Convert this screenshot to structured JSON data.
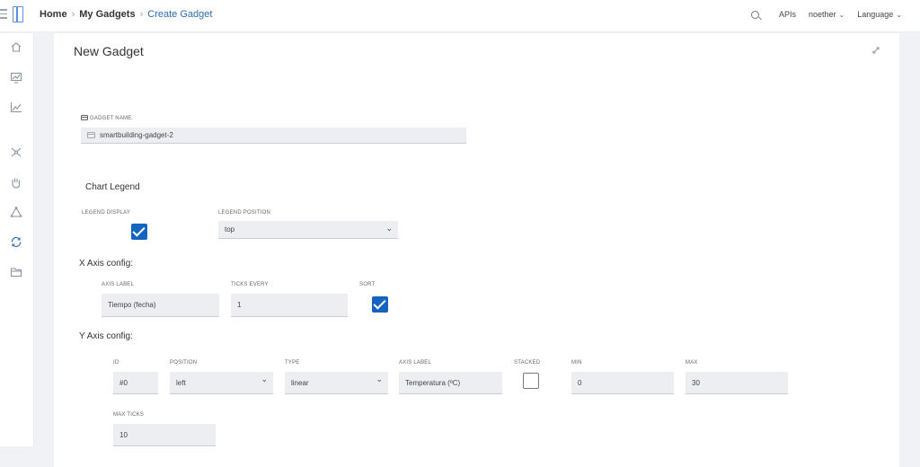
{
  "header": {
    "breadcrumb": [
      "Home",
      "My Gadgets",
      "Create Gadget"
    ],
    "apis": "APIs",
    "user": "noether",
    "language": "Language"
  },
  "page": {
    "title": "New Gadget"
  },
  "gadget": {
    "name_label": "GADGET NAME:",
    "name_value": "smartbuilding-gadget-2"
  },
  "legend": {
    "section_title": "Chart Legend",
    "display_label": "LEGEND DISPLAY",
    "display_checked": true,
    "position_label": "LEGEND POSITION",
    "position_value": "top"
  },
  "xaxis": {
    "section_title": "X Axis config:",
    "axis_label_label": "AXIS LABEL",
    "axis_label_value": "Tiempo (fecha)",
    "ticks_label": "TICKS EVERY",
    "ticks_value": "1",
    "sort_label": "SORT",
    "sort_checked": true
  },
  "yaxis": {
    "section_title": "Y Axis config:",
    "id_label": "ID",
    "id_value": "#0",
    "position_label": "POSITION",
    "position_value": "left",
    "type_label": "TYPE",
    "type_value": "linear",
    "axis_label_label": "AXIS LABEL",
    "axis_label_value": "Temperatura (ºC)",
    "stacked_label": "STACKED",
    "stacked_checked": false,
    "min_label": "MIN",
    "min_value": "0",
    "max_label": "MAX",
    "max_value": "30",
    "max_ticks_label": "MAX TICKS",
    "max_ticks_value": "10"
  },
  "colors": {
    "accent": "#2b6cb0",
    "checkbox": "#1565c0"
  }
}
